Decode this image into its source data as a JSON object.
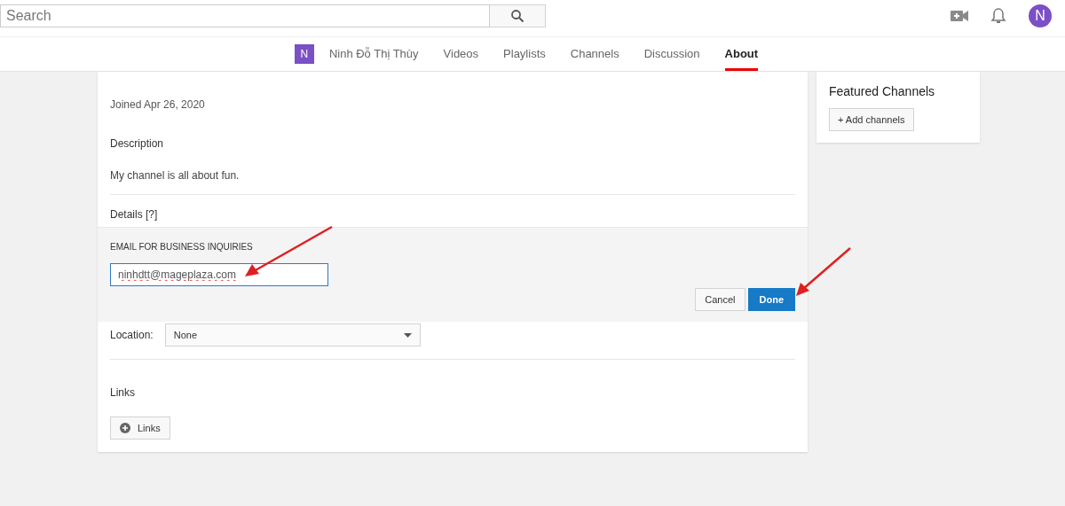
{
  "search": {
    "placeholder": "Search"
  },
  "account": {
    "avatar_letter": "N"
  },
  "channel": {
    "avatar_letter": "N",
    "name": "Ninh Đỗ Thị Thùy"
  },
  "tabs": [
    {
      "label": "Videos",
      "selected": false
    },
    {
      "label": "Playlists",
      "selected": false
    },
    {
      "label": "Channels",
      "selected": false
    },
    {
      "label": "Discussion",
      "selected": false
    },
    {
      "label": "About",
      "selected": true
    }
  ],
  "about": {
    "joined": "Joined Apr 26, 2020",
    "description_heading": "Description",
    "description": "My channel is all about fun.",
    "details_heading": "Details [?]",
    "email_editor": {
      "label": "EMAIL FOR BUSINESS INQUIRIES",
      "value": "ninhdtt@mageplaza.com",
      "cancel": "Cancel",
      "done": "Done"
    },
    "location": {
      "label": "Location:",
      "value": "None"
    },
    "links_heading": "Links",
    "links_button": "Links"
  },
  "featured": {
    "title": "Featured Channels",
    "button": "+ Add channels"
  }
}
